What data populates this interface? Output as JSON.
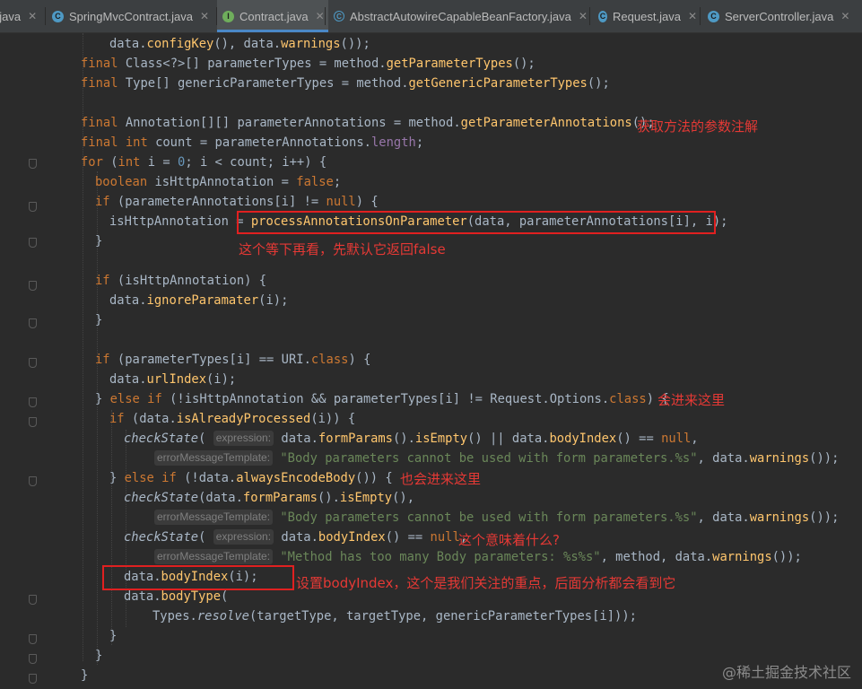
{
  "tabs": [
    {
      "label": "r.java",
      "icon": "class-icon",
      "active": false
    },
    {
      "label": "SpringMvcContract.java",
      "icon": "class-icon",
      "active": false
    },
    {
      "label": "Contract.java",
      "icon": "interface-icon",
      "active": true
    },
    {
      "label": "AbstractAutowireCapableBeanFactory.java",
      "icon": "abstract-class-icon",
      "active": false
    },
    {
      "label": "Request.java",
      "icon": "class-icon",
      "active": false
    },
    {
      "label": "ServerController.java",
      "icon": "class-icon",
      "active": false
    }
  ],
  "hints": {
    "expression": "expression:",
    "errorMessageTemplate": "errorMessageTemplate:"
  },
  "annotations": {
    "get_params": "获取方法的参数注解",
    "later": "这个等下再看，先默认它返回false",
    "will_enter": "会进来这里",
    "also_enter": "也会进来这里",
    "meaning": "这个意味着什么?",
    "set_body_index": "设置bodyIndex，这个是我们关注的重点，后面分析都会看到它"
  },
  "watermark": "@稀土掘金技术社区",
  "colors": {
    "background": "#2b2b2b",
    "keyword": "#cc7832",
    "string": "#6a8759",
    "number": "#6897bb",
    "field": "#9876aa",
    "annotation_red": "#e53935"
  }
}
